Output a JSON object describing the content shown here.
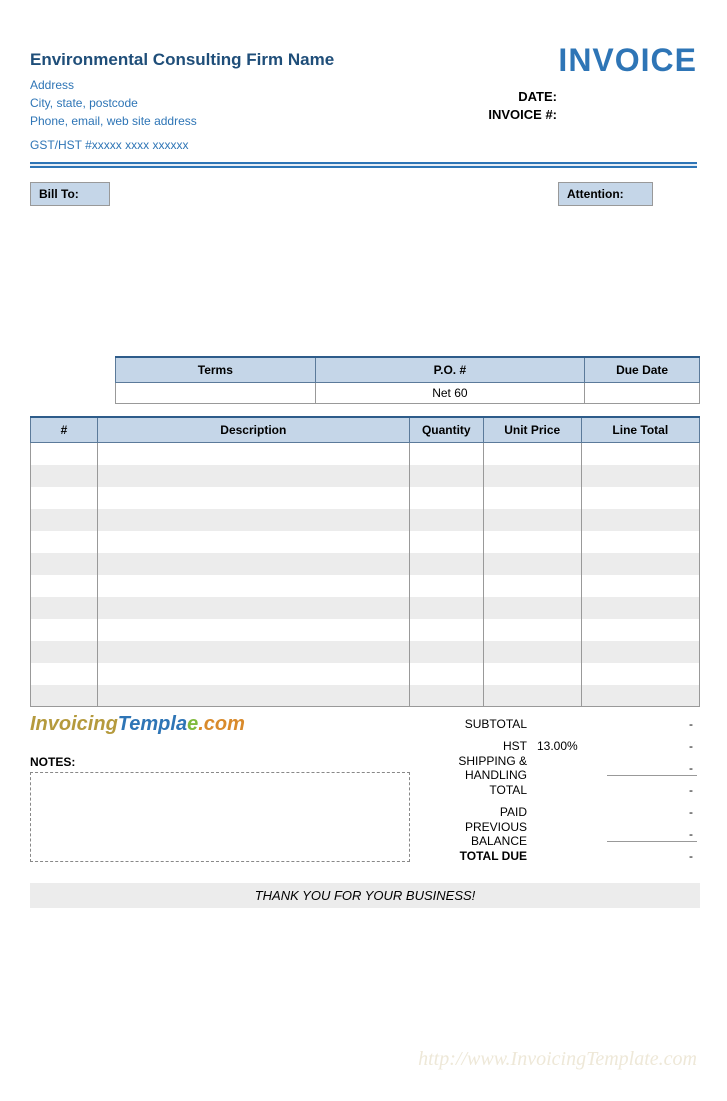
{
  "header": {
    "firm_name": "Environmental Consulting Firm Name",
    "address": "Address",
    "city_state_postcode": "City, state, postcode",
    "contact": "Phone, email, web site address",
    "gst": "GST/HST #xxxxx xxxx xxxxxx",
    "invoice_title": "INVOICE",
    "date_label": "DATE:",
    "invoice_no_label": "INVOICE #:"
  },
  "bill": {
    "bill_to_label": "Bill To:",
    "attention_label": "Attention:"
  },
  "terms": {
    "headers": {
      "terms": "Terms",
      "po": "P.O. #",
      "due": "Due Date"
    },
    "values": {
      "terms": "",
      "po": "Net 60",
      "due": ""
    }
  },
  "items": {
    "headers": {
      "num": "#",
      "desc": "Description",
      "qty": "Quantity",
      "price": "Unit Price",
      "total": "Line Total"
    }
  },
  "totals": {
    "subtotal_label": "SUBTOTAL",
    "subtotal_value": "-",
    "hst_label": "HST",
    "hst_rate": "13.00%",
    "hst_value": "-",
    "shipping_label": "SHIPPING & HANDLING",
    "shipping_value": "-",
    "total_label": "TOTAL",
    "total_value": "-",
    "paid_label": "PAID",
    "paid_value": "-",
    "prev_balance_label": "PREVIOUS BALANCE",
    "prev_balance_value": "-",
    "total_due_label": "TOTAL DUE",
    "total_due_value": "-"
  },
  "notes": {
    "label": "NOTES:"
  },
  "logo": {
    "part1": "Invoicing",
    "part2": "Templa",
    "part3": "e",
    "part4": ".com"
  },
  "footer": {
    "thank_you": "THANK YOU FOR YOUR BUSINESS!",
    "watermark": "http://www.InvoicingTemplate.com"
  }
}
